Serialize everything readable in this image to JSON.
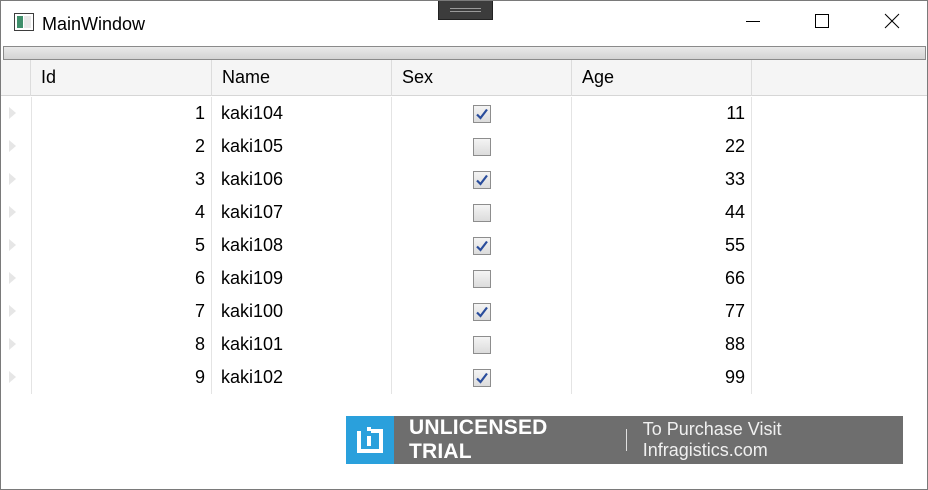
{
  "window": {
    "title": "MainWindow",
    "icons": {
      "app": "window-app-icon",
      "minimize": "minimize-icon",
      "maximize": "maximize-icon",
      "close": "close-icon"
    }
  },
  "grid": {
    "columns": [
      "Id",
      "Name",
      "Sex",
      "Age"
    ],
    "rows": [
      {
        "id": "1",
        "name": "kaki104",
        "sex": true,
        "age": "11"
      },
      {
        "id": "2",
        "name": "kaki105",
        "sex": false,
        "age": "22"
      },
      {
        "id": "3",
        "name": "kaki106",
        "sex": true,
        "age": "33"
      },
      {
        "id": "4",
        "name": "kaki107",
        "sex": false,
        "age": "44"
      },
      {
        "id": "5",
        "name": "kaki108",
        "sex": true,
        "age": "55"
      },
      {
        "id": "6",
        "name": "kaki109",
        "sex": false,
        "age": "66"
      },
      {
        "id": "7",
        "name": "kaki100",
        "sex": true,
        "age": "77"
      },
      {
        "id": "8",
        "name": "kaki101",
        "sex": false,
        "age": "88"
      },
      {
        "id": "9",
        "name": "kaki102",
        "sex": true,
        "age": "99"
      }
    ]
  },
  "watermark": {
    "main": "UNLICENSED TRIAL",
    "sub": "To Purchase Visit Infragistics.com",
    "icon": "infragistics-logo-icon"
  },
  "colors": {
    "checkmark": "#2a4d9c",
    "watermark_bg": "#6e6e6e",
    "logo_bg": "#2aa0dc"
  }
}
